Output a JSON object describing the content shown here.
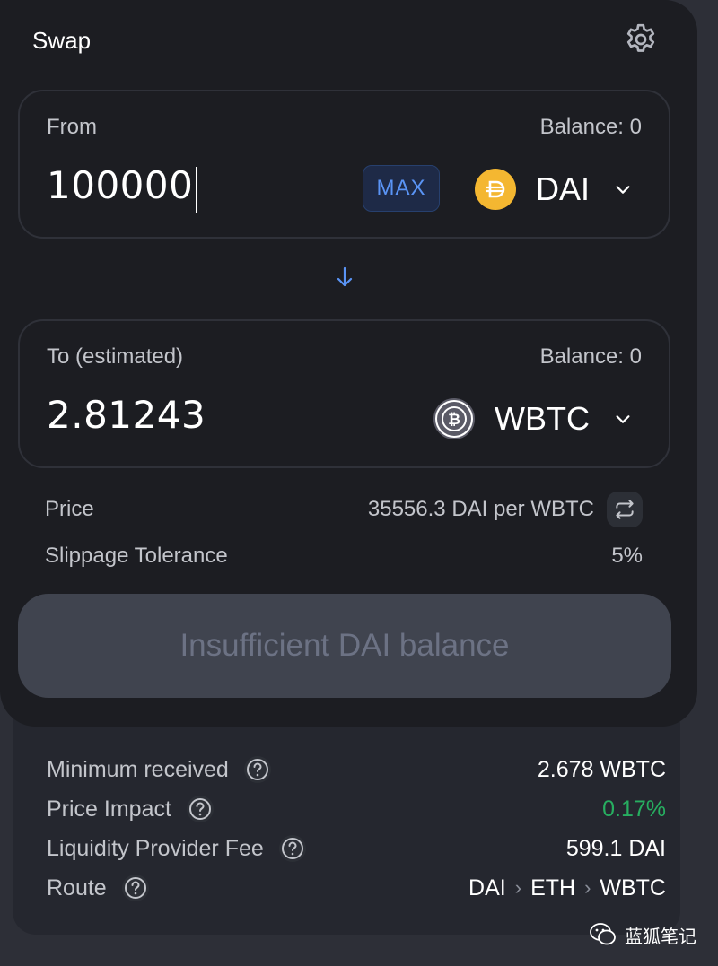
{
  "header": {
    "title": "Swap",
    "settings_icon": "gear-icon"
  },
  "from": {
    "label": "From",
    "balance": "Balance: 0",
    "amount": "100000",
    "max_label": "MAX",
    "token": {
      "symbol": "DAI",
      "icon": "dai-icon",
      "color": "#f4b731"
    }
  },
  "direction_icon": "arrow-down-icon",
  "to": {
    "label": "To (estimated)",
    "balance": "Balance: 0",
    "amount": "2.81243",
    "token": {
      "symbol": "WBTC",
      "icon": "wbtc-icon"
    }
  },
  "price": {
    "label": "Price",
    "value": "35556.3 DAI per WBTC"
  },
  "slippage": {
    "label": "Slippage Tolerance",
    "value": "5%"
  },
  "main_button": {
    "label": "Insufficient DAI balance",
    "disabled": true
  },
  "details": {
    "minimum_received": {
      "label": "Minimum received",
      "value": "2.678 WBTC"
    },
    "price_impact": {
      "label": "Price Impact",
      "value": "0.17%",
      "color": "#27ae60"
    },
    "lp_fee": {
      "label": "Liquidity Provider Fee",
      "value": "599.1 DAI"
    },
    "route": {
      "label": "Route",
      "hops": [
        "DAI",
        "ETH",
        "WBTC"
      ]
    }
  },
  "watermark": {
    "text": "蓝狐笔记"
  },
  "colors": {
    "accent": "#5a94f5",
    "card": "#1c1d22",
    "background": "#2d2f37"
  }
}
